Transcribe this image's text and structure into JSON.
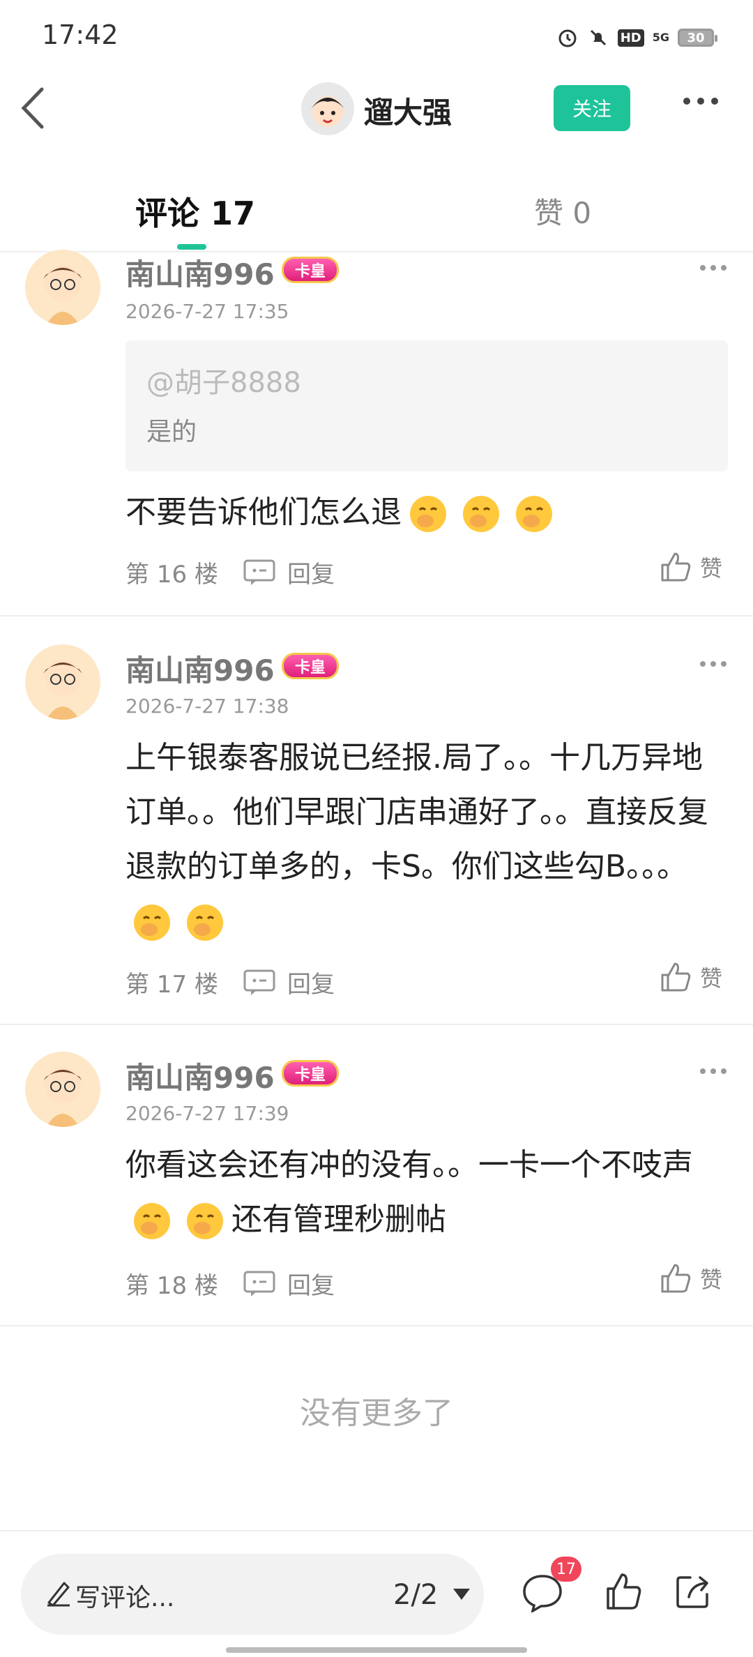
{
  "status_bar": {
    "time": "17:42",
    "network": "5G",
    "hd_label": "HD",
    "battery": "30"
  },
  "header": {
    "author_name": "遛大强",
    "follow_label": "关注"
  },
  "tabs": {
    "comments_label": "评论 17",
    "likes_label": "赞 0"
  },
  "comments": [
    {
      "user": "南山南996",
      "badge": "卡皇",
      "time": "2026-7-27 17:35",
      "quote": {
        "user": "@胡子8888",
        "text": "是的"
      },
      "text": "不要告诉他们怎么退",
      "floor": "第 16 楼",
      "reply_label": "回复",
      "like_label": "赞"
    },
    {
      "user": "南山南996",
      "badge": "卡皇",
      "time": "2026-7-27 17:38",
      "text": "上午银泰客服说已经报.局了。。十几万异地订单。。他们早跟门店串通好了。。直接反复退款的订单多的，卡S。你们这些勾B。。。",
      "floor": "第 17 楼",
      "reply_label": "回复",
      "like_label": "赞"
    },
    {
      "user": "南山南996",
      "badge": "卡皇",
      "time": "2026-7-27 17:39",
      "text_part1": "你看这会还有冲的没有。。一卡一个不吱声",
      "text_part2": "还有管理秒删帖",
      "floor": "第 18 楼",
      "reply_label": "回复",
      "like_label": "赞"
    }
  ],
  "footer": {
    "no_more": "没有更多了"
  },
  "bottom_bar": {
    "write_placeholder": "写评论...",
    "page_indicator": "2/2",
    "comment_count": "17"
  },
  "colors": {
    "accent": "#1ec39a",
    "badge_red": "#f0465a"
  },
  "icons": [
    "back-arrow-icon",
    "alarm-icon",
    "mute-icon",
    "pencil-icon",
    "comment-icon",
    "thumbs-up-icon",
    "share-icon",
    "reply-icon",
    "more-dots-icon"
  ]
}
